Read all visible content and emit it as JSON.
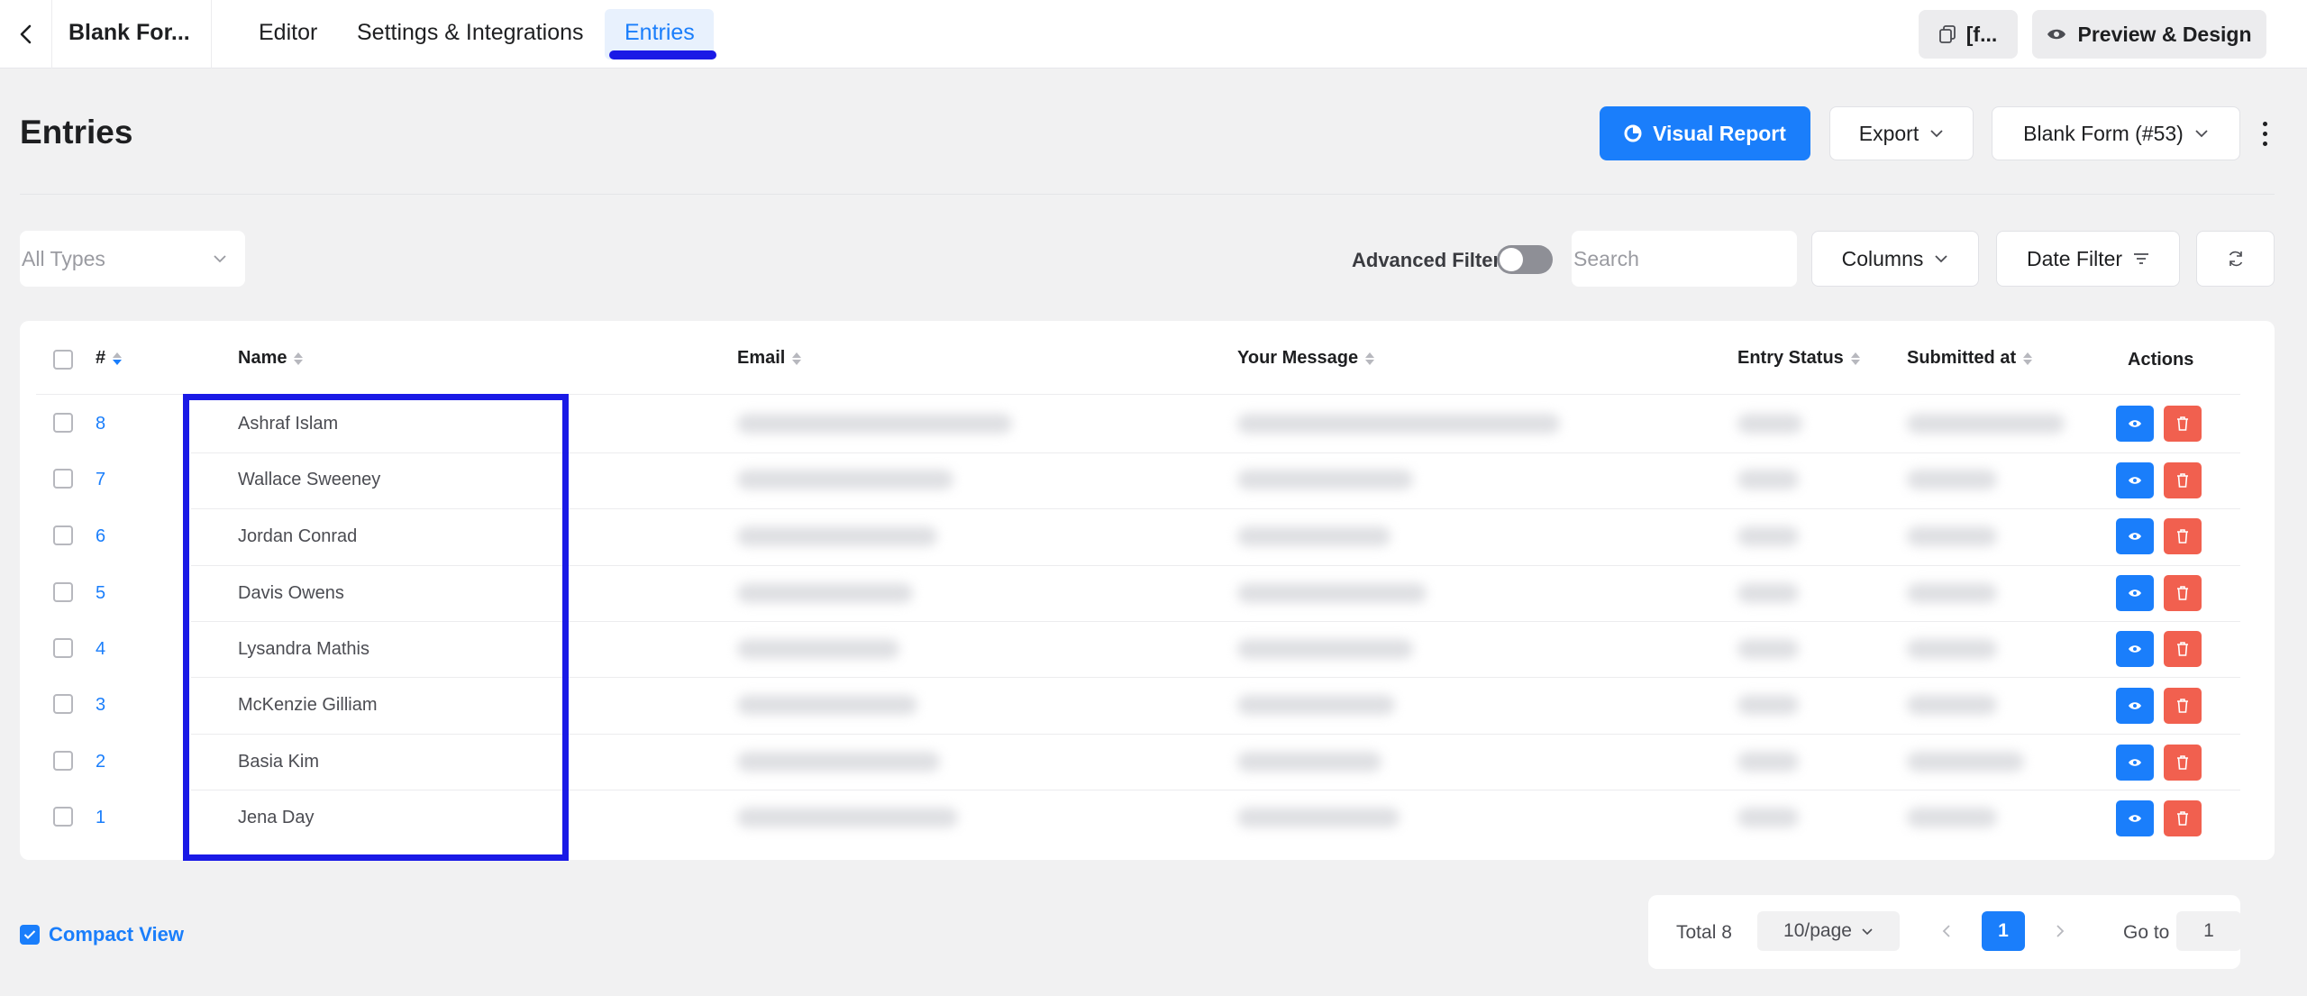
{
  "topbar": {
    "form_name": "Blank For...",
    "tabs": [
      {
        "label": "Editor"
      },
      {
        "label": "Settings & Integrations"
      },
      {
        "label": "Entries"
      }
    ],
    "shortcode_label": "[f...",
    "preview_label": "Preview & Design"
  },
  "header": {
    "title": "Entries",
    "visual_report_label": "Visual Report",
    "export_label": "Export",
    "form_select_label": "Blank Form (#53)"
  },
  "filters": {
    "types_placeholder": "All Types",
    "advanced_filter_label": "Advanced Filter",
    "advanced_filter_on": false,
    "search_placeholder": "Search",
    "columns_label": "Columns",
    "date_filter_label": "Date Filter"
  },
  "table": {
    "columns": [
      "#",
      "Name",
      "Email",
      "Your Message",
      "Entry Status",
      "Submitted at",
      "Actions"
    ],
    "rows": [
      {
        "id": "8",
        "name": "Ashraf Islam"
      },
      {
        "id": "7",
        "name": "Wallace Sweeney"
      },
      {
        "id": "6",
        "name": "Jordan Conrad"
      },
      {
        "id": "5",
        "name": "Davis Owens"
      },
      {
        "id": "4",
        "name": "Lysandra Mathis"
      },
      {
        "id": "3",
        "name": "McKenzie Gilliam"
      },
      {
        "id": "2",
        "name": "Basia Kim"
      },
      {
        "id": "1",
        "name": "Jena Day"
      }
    ]
  },
  "footer": {
    "compact_view_label": "Compact View",
    "compact_view_checked": true,
    "total_label": "Total 8",
    "per_page_label": "10/page",
    "current_page": "1",
    "goto_label": "Go to",
    "goto_value": "1"
  },
  "colors": {
    "primary": "#1a7efb",
    "danger": "#f1604f",
    "highlight": "#1a1ae6"
  }
}
